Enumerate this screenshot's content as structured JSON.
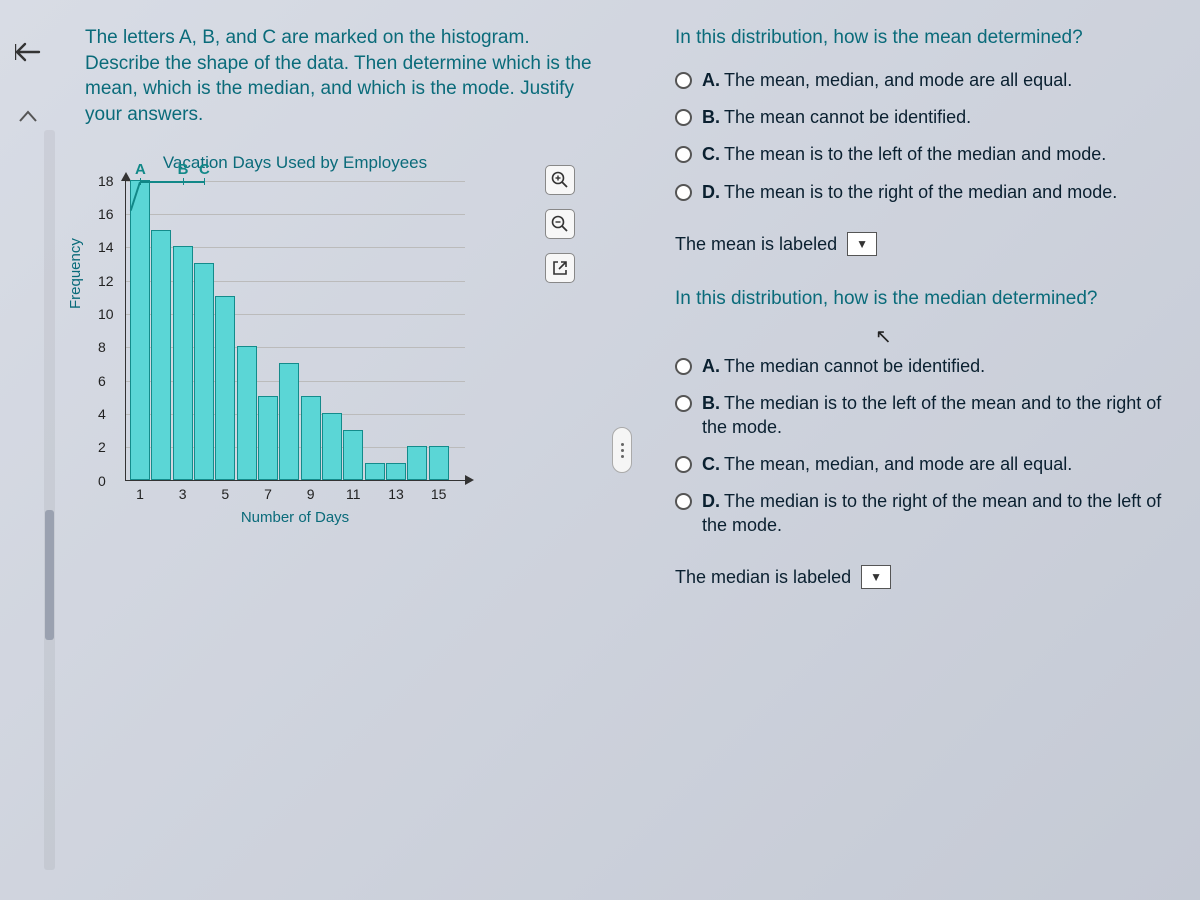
{
  "prompt": "The letters A, B, and C are marked on the histogram. Describe the shape of the data. Then determine which is the mean, which is the median, and which is the mode. Justify your answers.",
  "chart_data": {
    "type": "bar",
    "title": "Vacation Days Used by Employees",
    "xlabel": "Number of Days",
    "ylabel": "Frequency",
    "categories": [
      1,
      2,
      3,
      4,
      5,
      6,
      7,
      8,
      9,
      10,
      11,
      12,
      13,
      14,
      15
    ],
    "values": [
      18,
      15,
      14,
      13,
      11,
      8,
      5,
      7,
      5,
      4,
      3,
      1,
      1,
      2,
      2
    ],
    "ylim": [
      0,
      18
    ],
    "y_ticks": [
      0,
      2,
      4,
      6,
      8,
      10,
      12,
      14,
      16,
      18
    ],
    "x_ticks": [
      1,
      3,
      5,
      7,
      9,
      11,
      13,
      15
    ],
    "markers": [
      {
        "label": "A",
        "x": 1
      },
      {
        "label": "B",
        "x": 3
      },
      {
        "label": "C",
        "x": 4
      }
    ]
  },
  "q1": {
    "heading": "In this distribution, how is the mean determined?",
    "options": {
      "A": "The mean, median, and mode are all equal.",
      "B": "The mean cannot be identified.",
      "C": "The mean is to the left of the median and mode.",
      "D": "The mean is to the right of the median and mode."
    },
    "fill_label": "The mean is labeled"
  },
  "q2": {
    "heading": "In this distribution, how is the median determined?",
    "options": {
      "A": "The median cannot be identified.",
      "B": "The median is to the left of the mean and to the right of the mode.",
      "C": "The mean, median, and mode are all equal.",
      "D": "The median is to the right of the mean and to the left of the mode."
    },
    "fill_label": "The median is labeled"
  },
  "letters": {
    "A": "A.",
    "B": "B.",
    "C": "C.",
    "D": "D."
  },
  "select_glyph": "▼"
}
